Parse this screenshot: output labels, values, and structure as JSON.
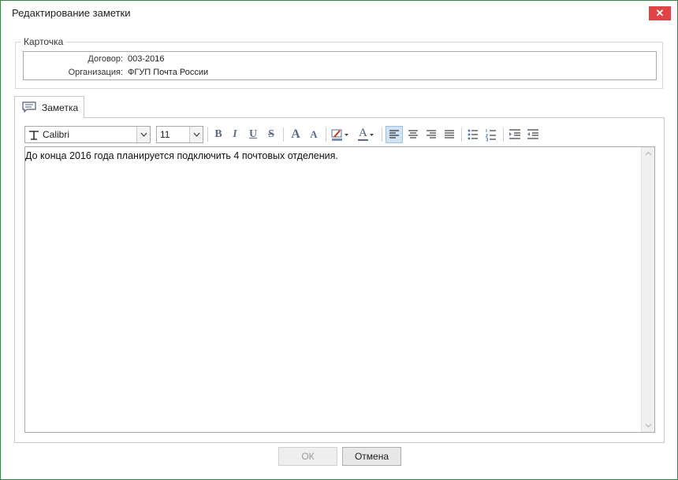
{
  "window": {
    "title": "Редактирование заметки",
    "close_glyph": "✕"
  },
  "card": {
    "legend": "Карточка",
    "fields": [
      {
        "label": "Договор:",
        "value": "003-2016"
      },
      {
        "label": "Организация:",
        "value": "ФГУП Почта России"
      }
    ]
  },
  "tabs": [
    {
      "label": "Заметка",
      "icon": "comment-icon"
    }
  ],
  "toolbar": {
    "font_name": "Calibri",
    "font_size": "11",
    "bold": "B",
    "italic": "I",
    "underline": "U",
    "strike": "S",
    "grow": "A",
    "shrink": "A",
    "font_color": "A",
    "highlight_icon": "highlight-icon",
    "active_align": "left"
  },
  "editor": {
    "content": "До конца 2016 года планируется подключить 4 почтовых отделения."
  },
  "buttons": {
    "ok": "ОК",
    "cancel": "Отмена"
  }
}
